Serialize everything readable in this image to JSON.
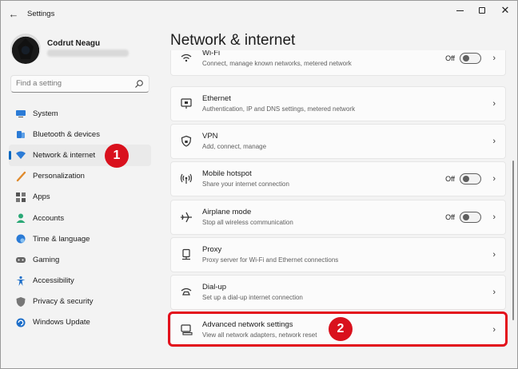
{
  "window": {
    "title": "Settings",
    "back": "←",
    "close": "✕"
  },
  "profile": {
    "name": "Codrut Neagu"
  },
  "search": {
    "placeholder": "Find a setting"
  },
  "sidebar": {
    "items": [
      {
        "label": "System",
        "icon": "monitor-icon",
        "color": "#2b7bd6"
      },
      {
        "label": "Bluetooth & devices",
        "icon": "bluetooth-icon",
        "color": "#2b7bd6"
      },
      {
        "label": "Network & internet",
        "icon": "wifi-icon",
        "color": "#2b7bd6",
        "selected": true
      },
      {
        "label": "Personalization",
        "icon": "brush-icon",
        "color": "#e08a2c"
      },
      {
        "label": "Apps",
        "icon": "apps-icon",
        "color": "#555555"
      },
      {
        "label": "Accounts",
        "icon": "person-icon",
        "color": "#2aa876"
      },
      {
        "label": "Time & language",
        "icon": "globe-icon",
        "color": "#2b7bd6"
      },
      {
        "label": "Gaming",
        "icon": "gamepad-icon",
        "color": "#666666"
      },
      {
        "label": "Accessibility",
        "icon": "accessibility-icon",
        "color": "#1f6fc9"
      },
      {
        "label": "Privacy & security",
        "icon": "shield-icon",
        "color": "#777777"
      },
      {
        "label": "Windows Update",
        "icon": "update-icon",
        "color": "#1f6fc9"
      }
    ]
  },
  "badges": {
    "one": "1",
    "two": "2"
  },
  "main": {
    "title": "Network & internet",
    "cards": [
      {
        "title": "Wi-Fi",
        "subtitle": "Connect, manage known networks, metered network",
        "icon": "wifi-icon",
        "toggle": "Off"
      },
      {
        "title": "Ethernet",
        "subtitle": "Authentication, IP and DNS settings, metered network",
        "icon": "ethernet-icon"
      },
      {
        "title": "VPN",
        "subtitle": "Add, connect, manage",
        "icon": "vpn-shield-icon"
      },
      {
        "title": "Mobile hotspot",
        "subtitle": "Share your internet connection",
        "icon": "hotspot-icon",
        "toggle": "Off"
      },
      {
        "title": "Airplane mode",
        "subtitle": "Stop all wireless communication",
        "icon": "airplane-icon",
        "toggle": "Off"
      },
      {
        "title": "Proxy",
        "subtitle": "Proxy server for Wi-Fi and Ethernet connections",
        "icon": "proxy-icon"
      },
      {
        "title": "Dial-up",
        "subtitle": "Set up a dial-up internet connection",
        "icon": "dialup-icon"
      },
      {
        "title": "Advanced network settings",
        "subtitle": "View all network adapters, network reset",
        "icon": "advanced-network-icon"
      }
    ]
  },
  "colors": {
    "accent": "#0067c0",
    "callout": "#e3101c"
  }
}
